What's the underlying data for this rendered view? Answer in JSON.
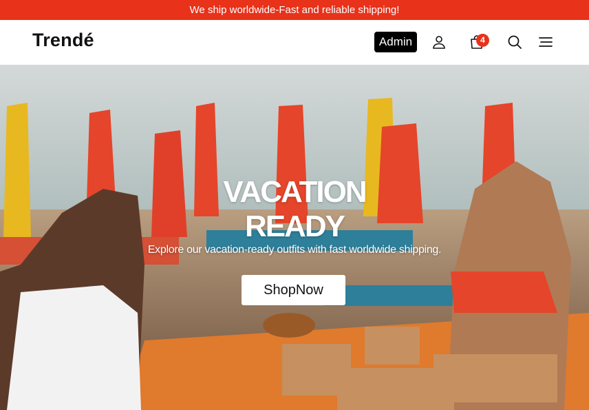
{
  "announcement": {
    "text": "We ship worldwide-Fast and reliable shipping!"
  },
  "navbar": {
    "brand": "Trendé",
    "admin_label": "Admin",
    "cart_count": "4",
    "icons": [
      "user-icon",
      "shopping-bag-icon",
      "search-icon",
      "menu-icon"
    ]
  },
  "hero": {
    "title_line1": "VACATION",
    "title_line2": "READY",
    "subtitle": "Explore our vacation-ready outfits with fast worldwide shipping.",
    "cta_label": "ShopNow"
  },
  "colors": {
    "accent": "#e8321a",
    "admin_bg": "#000000",
    "text_dark": "#111111"
  }
}
